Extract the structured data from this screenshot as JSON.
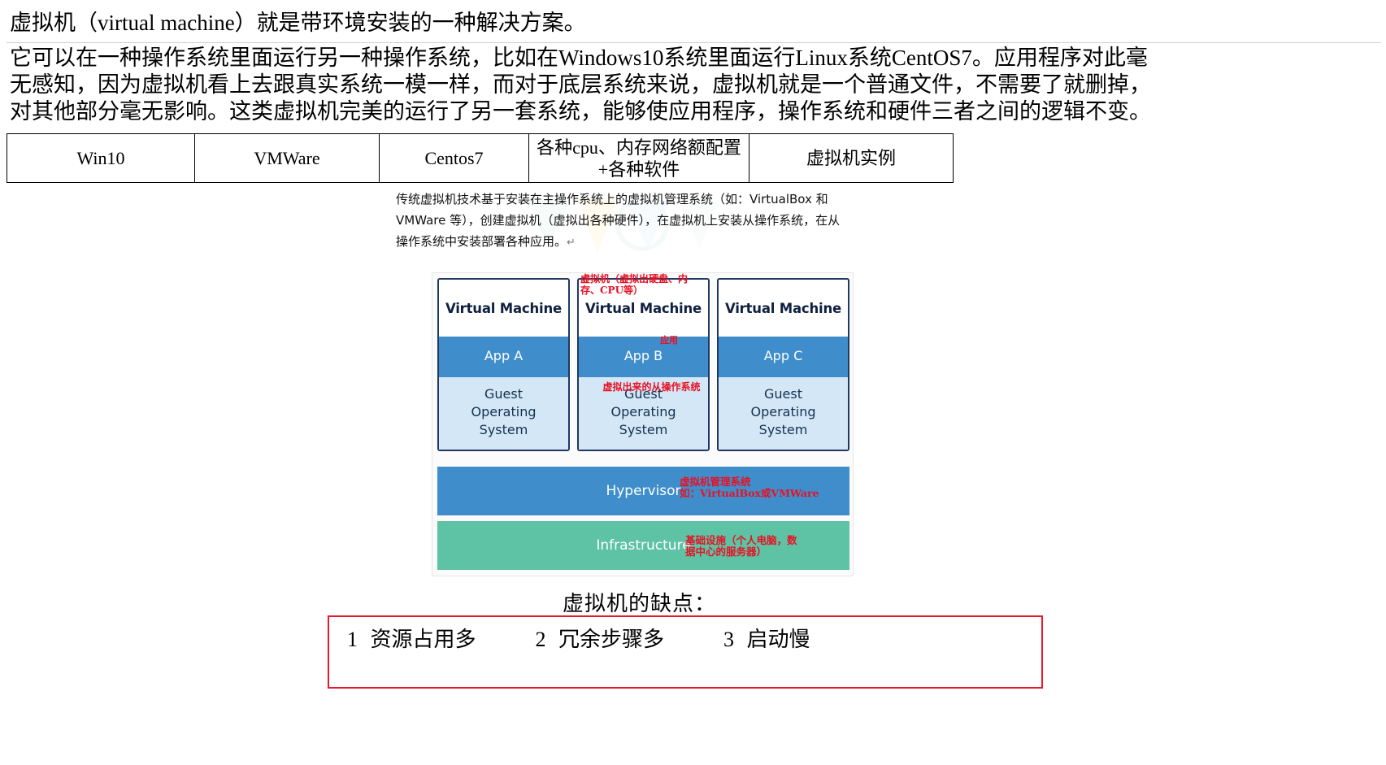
{
  "intro": {
    "paragraph1": "虚拟机（virtual machine）就是带环境安装的一种解决方案。",
    "paragraph2_lines": [
      "它可以在一种操作系统里面运行另一种操作系统，比如在Windows10系统里面运行Linux系统CentOS7。应用程序对此毫",
      "无感知，因为虚拟机看上去跟真实系统一模一样，而对于底层系统来说，虚拟机就是一个普通文件，不需要了就删掉，",
      "对其他部分毫无影响。这类虚拟机完美的运行了另一套系统，能够使应用程序，操作系统和硬件三者之间的逻辑不变。"
    ]
  },
  "table": {
    "cells": [
      "Win10",
      "VMWare",
      "Centos7",
      "各种cpu、内存网络额配置+各种软件",
      "虚拟机实例"
    ]
  },
  "explain": {
    "lines": [
      "传统虚拟机技术基于安装在主操作系统上的虚拟机管理系统（如：VirtualBox 和",
      "VMWare 等），创建虚拟机（虚拟出各种硬件），在虚拟机上安装从操作系统，在从",
      "操作系统中安装部署各种应用。"
    ],
    "pilcrow": "↵"
  },
  "diagram": {
    "vms": [
      {
        "title": "Virtual Machine",
        "app": "App A",
        "guest_line1": "Guest",
        "guest_line2": "Operating",
        "guest_line3": "System"
      },
      {
        "title": "Virtual Machine",
        "app": "App B",
        "guest_line1": "Guest",
        "guest_line2": "Operating",
        "guest_line3": "System"
      },
      {
        "title": "Virtual Machine",
        "app": "App C",
        "guest_line1": "Guest",
        "guest_line2": "Operating",
        "guest_line3": "System"
      }
    ],
    "hypervisor": "Hypervisor",
    "infrastructure": "Infrastructure",
    "annotations": {
      "vm": "虚拟机（虚拟出硬盘、内\n存、CPU等）",
      "app": "应用",
      "guest": "虚拟出来的从操作系统",
      "hypervisor": "虚拟机管理系统\n如：VirtualBox或VMWare",
      "infrastructure": "基础设施（个人电脑，数\n据中心的服务器）"
    },
    "colors": {
      "app_band": "#3f8ecb",
      "guest_band": "#d3e7f7",
      "hypervisor_band": "#3f8ecb",
      "infrastructure_band": "#5ec2a4",
      "box_border": "#1f3864",
      "annotation": "#e81123"
    }
  },
  "drawbacks": {
    "title": "虚拟机的缺点：",
    "items": [
      {
        "num": "1",
        "text": "资源占用多"
      },
      {
        "num": "2",
        "text": "冗余步骤多"
      },
      {
        "num": "3",
        "text": "启动慢"
      }
    ],
    "border_color": "#e8192c"
  }
}
